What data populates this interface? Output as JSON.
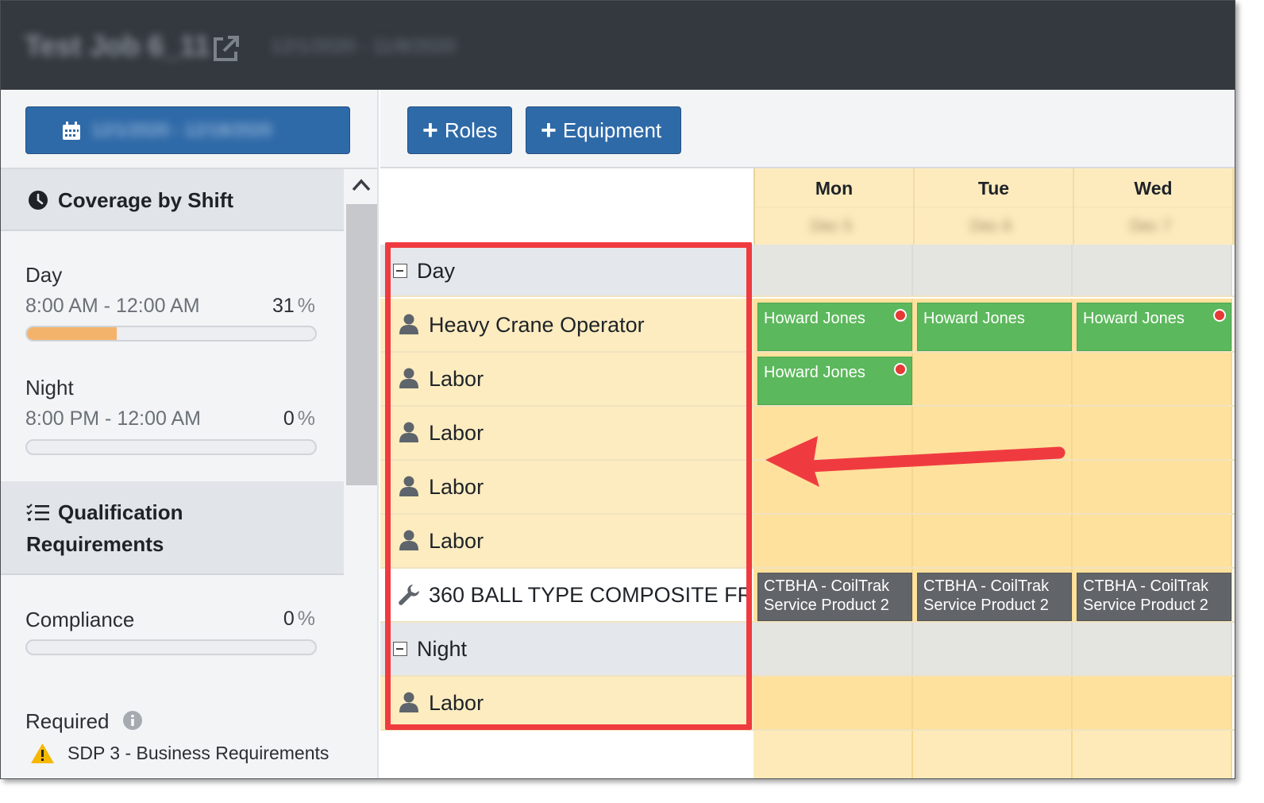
{
  "header": {
    "job_title": "Test Job 6_11",
    "job_dates": "12/1/2020 - 11/8/2020"
  },
  "left_panel": {
    "date_range": "12/1/2020 - 12/18/2020",
    "coverage": {
      "title": "Coverage by Shift",
      "shifts": [
        {
          "name": "Day",
          "time": "8:00 AM - 12:00 AM",
          "percent": "31",
          "fill": 0.31
        },
        {
          "name": "Night",
          "time": "8:00 PM - 12:00 AM",
          "percent": "0",
          "fill": 0
        }
      ],
      "percent_sign": "%"
    },
    "qualification": {
      "title_line1": "Qualification",
      "title_line2": "Requirements",
      "compliance_label": "Compliance",
      "compliance_percent": "0",
      "compliance_fill": 0,
      "required_label": "Required",
      "requirement_item": "SDP 3 - Business Requirements"
    }
  },
  "toolbar": {
    "roles_label": "Roles",
    "equipment_label": "Equipment"
  },
  "schedule": {
    "days": [
      {
        "name": "Mon",
        "date": "Dec 5"
      },
      {
        "name": "Tue",
        "date": "Dec 6"
      },
      {
        "name": "Wed",
        "date": "Dec 7"
      }
    ],
    "rows": [
      {
        "type": "shift",
        "label": "Day"
      },
      {
        "type": "role",
        "label": "Heavy Crane Operator"
      },
      {
        "type": "role",
        "label": "Labor"
      },
      {
        "type": "role",
        "label": "Labor"
      },
      {
        "type": "role",
        "label": "Labor"
      },
      {
        "type": "role",
        "label": "Labor"
      },
      {
        "type": "equipment",
        "label": "360 BALL TYPE COMPOSITE FR..."
      },
      {
        "type": "shift",
        "label": "Night"
      },
      {
        "type": "role",
        "label": "Labor"
      }
    ],
    "assignment_name": "Howard Jones",
    "equipment_line1": "CTBHA - CoilTrak",
    "equipment_line2": "Service Product 2"
  },
  "colors": {
    "primary_button": "#2f6aa8",
    "assigned_chip": "#5cb85c",
    "equipment_chip": "#616468",
    "alert": "#e53935",
    "highlight": "#ef3b40",
    "progress_fill": "#f4b36b"
  }
}
